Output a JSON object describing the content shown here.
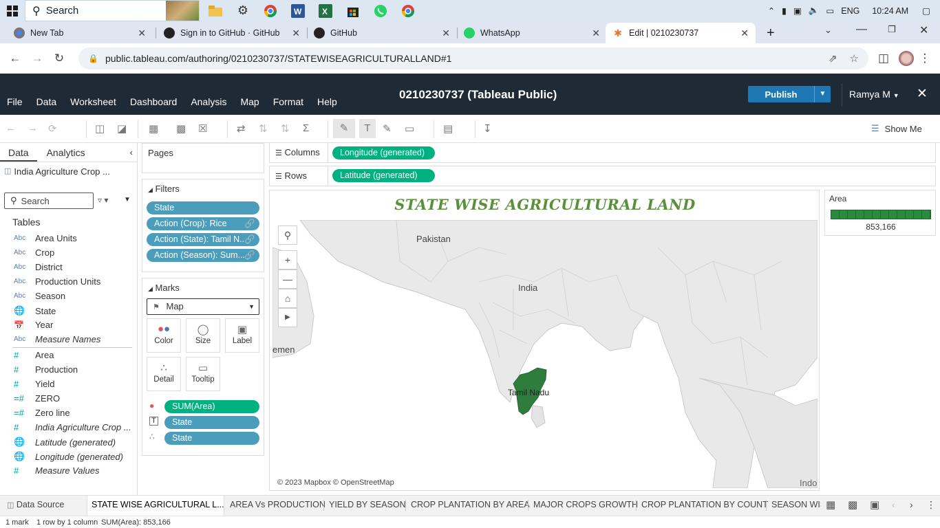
{
  "taskbar": {
    "search_placeholder": "Search",
    "language": "ENG",
    "time": "10:24 AM"
  },
  "browser": {
    "tabs": [
      {
        "title": "New Tab"
      },
      {
        "title": "Sign in to GitHub · GitHub"
      },
      {
        "title": "GitHub"
      },
      {
        "title": "WhatsApp"
      },
      {
        "title": "Edit | 0210230737"
      }
    ],
    "new_tab_symbol": "+",
    "url": "public.tableau.com/authoring/0210230737/STATEWISEAGRICULTURALLAND#1"
  },
  "tableau": {
    "menu": [
      "File",
      "Data",
      "Worksheet",
      "Dashboard",
      "Analysis",
      "Map",
      "Format",
      "Help"
    ],
    "workbook_title": "0210230737 (Tableau Public)",
    "publish_label": "Publish",
    "user_label": "Ramya M",
    "show_me_label": "Show Me"
  },
  "data_pane": {
    "tab_data": "Data",
    "tab_analytics": "Analytics",
    "data_source": "India Agriculture Crop ...",
    "search_placeholder": "Search",
    "tables_label": "Tables",
    "dimensions": [
      {
        "type": "Abc",
        "name": "Area Units",
        "italic": false
      },
      {
        "type": "Abc",
        "name": "Crop",
        "italic": false
      },
      {
        "type": "Abc",
        "name": "District",
        "italic": false
      },
      {
        "type": "Abc",
        "name": "Production Units",
        "italic": false
      },
      {
        "type": "Abc",
        "name": "Season",
        "italic": false
      },
      {
        "type": "globe",
        "name": "State",
        "italic": false
      },
      {
        "type": "calendar",
        "name": "Year",
        "italic": false
      },
      {
        "type": "Abc",
        "name": "Measure Names",
        "italic": true
      }
    ],
    "measures": [
      {
        "type": "#",
        "name": "Area",
        "italic": false
      },
      {
        "type": "#",
        "name": "Production",
        "italic": false
      },
      {
        "type": "#",
        "name": "Yield",
        "italic": false
      },
      {
        "type": "=#",
        "name": "ZERO",
        "italic": false
      },
      {
        "type": "=#",
        "name": "Zero line",
        "italic": false
      },
      {
        "type": "#",
        "name": "India Agriculture Crop ...",
        "italic": true
      },
      {
        "type": "globe",
        "name": "Latitude (generated)",
        "italic": true
      },
      {
        "type": "globe",
        "name": "Longitude (generated)",
        "italic": true
      },
      {
        "type": "#",
        "name": "Measure Values",
        "italic": true
      }
    ]
  },
  "cards": {
    "pages_title": "Pages",
    "filters_title": "Filters",
    "filters": [
      "State",
      "Action (Crop): Rice",
      "Action (State): Tamil N...",
      "Action (Season): Sum..."
    ],
    "marks_title": "Marks",
    "mark_type": "Map",
    "mark_buttons": {
      "color": "Color",
      "size": "Size",
      "label": "Label",
      "detail": "Detail",
      "tooltip": "Tooltip"
    },
    "mark_pills": [
      "SUM(Area)",
      "State",
      "State"
    ]
  },
  "shelves": {
    "columns_label": "Columns",
    "columns_pill": "Longitude (generated)",
    "rows_label": "Rows",
    "rows_pill": "Latitude (generated)"
  },
  "view": {
    "title": "STATE WISE AGRICULTURAL LAND",
    "map_labels": {
      "pakistan": "Pakistan",
      "india": "India",
      "yemen": "emen",
      "tamil_nadu": "Tamil Nadu",
      "indo": "Indo"
    },
    "credit": "© 2023 Mapbox  © OpenStreetMap",
    "highlight_color": "#2e7d3c"
  },
  "legend": {
    "title": "Area",
    "value": "853,166",
    "color": "#2a8a3f"
  },
  "sheet_tabs": {
    "data_source": "Data Source",
    "tabs": [
      "STATE WISE AGRICULTURAL L...",
      "AREA Vs PRODUCTION",
      "YIELD BY SEASON",
      "CROP PLANTATION BY AREA",
      "MAJOR CROPS GROWTH",
      "CROP PLANTATION BY COUNT",
      "SEASON WIS"
    ]
  },
  "status": {
    "marks": "1 mark",
    "dims": "1 row by 1 column",
    "sum": "SUM(Area): 853,166"
  }
}
